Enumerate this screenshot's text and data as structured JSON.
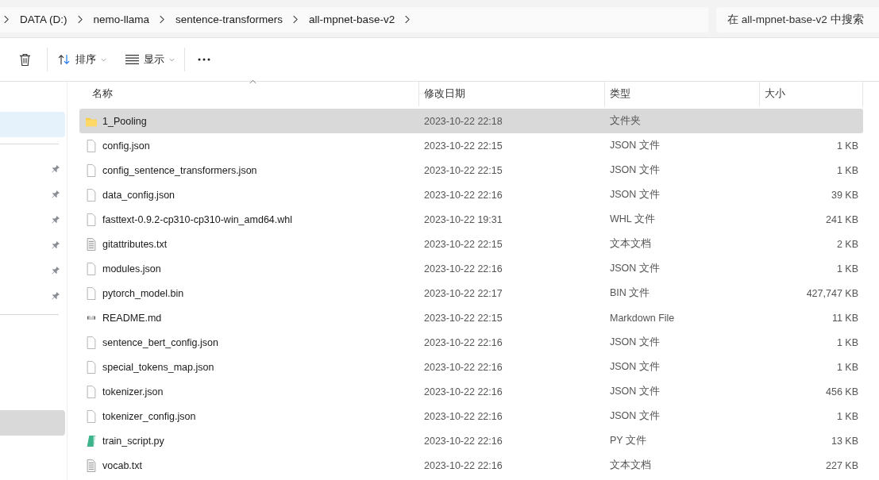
{
  "breadcrumb": {
    "crumbs": [
      "DATA (D:)",
      "nemo-llama",
      "sentence-transformers",
      "all-mpnet-base-v2"
    ]
  },
  "search": {
    "placeholder": "在 all-mpnet-base-v2 中搜索"
  },
  "toolbar": {
    "sort_label": "排序",
    "view_label": "显示"
  },
  "sidebar": {
    "items": [
      {
        "selected": true,
        "hovered": false,
        "pinned": false
      },
      {
        "selected": false,
        "hovered": false,
        "pinned": true
      },
      {
        "selected": false,
        "hovered": false,
        "pinned": true
      },
      {
        "selected": false,
        "hovered": false,
        "pinned": true
      },
      {
        "selected": false,
        "hovered": false,
        "pinned": true
      },
      {
        "selected": false,
        "hovered": false,
        "pinned": true
      },
      {
        "selected": false,
        "hovered": false,
        "pinned": true
      },
      {
        "selected": false,
        "hovered": true,
        "pinned": false
      }
    ]
  },
  "table": {
    "columns": [
      "名称",
      "修改日期",
      "类型",
      "大小"
    ],
    "rows": [
      {
        "kind": "folder",
        "name": "1_Pooling",
        "date": "2023-10-22 22:18",
        "type": "文件夹",
        "size": "",
        "selected": true
      },
      {
        "kind": "file",
        "name": "config.json",
        "date": "2023-10-22 22:15",
        "type": "JSON 文件",
        "size": "1 KB",
        "selected": false
      },
      {
        "kind": "file",
        "name": "config_sentence_transformers.json",
        "date": "2023-10-22 22:15",
        "type": "JSON 文件",
        "size": "1 KB",
        "selected": false
      },
      {
        "kind": "file",
        "name": "data_config.json",
        "date": "2023-10-22 22:16",
        "type": "JSON 文件",
        "size": "39 KB",
        "selected": false
      },
      {
        "kind": "file",
        "name": "fasttext-0.9.2-cp310-cp310-win_amd64.whl",
        "date": "2023-10-22 19:31",
        "type": "WHL 文件",
        "size": "241 KB",
        "selected": false
      },
      {
        "kind": "text",
        "name": "gitattributes.txt",
        "date": "2023-10-22 22:15",
        "type": "文本文档",
        "size": "2 KB",
        "selected": false
      },
      {
        "kind": "file",
        "name": "modules.json",
        "date": "2023-10-22 22:16",
        "type": "JSON 文件",
        "size": "1 KB",
        "selected": false
      },
      {
        "kind": "file",
        "name": "pytorch_model.bin",
        "date": "2023-10-22 22:17",
        "type": "BIN 文件",
        "size": "427,747 KB",
        "selected": false
      },
      {
        "kind": "markdown",
        "name": "README.md",
        "date": "2023-10-22 22:15",
        "type": "Markdown File",
        "size": "11 KB",
        "selected": false
      },
      {
        "kind": "file",
        "name": "sentence_bert_config.json",
        "date": "2023-10-22 22:16",
        "type": "JSON 文件",
        "size": "1 KB",
        "selected": false
      },
      {
        "kind": "file",
        "name": "special_tokens_map.json",
        "date": "2023-10-22 22:16",
        "type": "JSON 文件",
        "size": "1 KB",
        "selected": false
      },
      {
        "kind": "file",
        "name": "tokenizer.json",
        "date": "2023-10-22 22:16",
        "type": "JSON 文件",
        "size": "456 KB",
        "selected": false
      },
      {
        "kind": "file",
        "name": "tokenizer_config.json",
        "date": "2023-10-22 22:16",
        "type": "JSON 文件",
        "size": "1 KB",
        "selected": false
      },
      {
        "kind": "python",
        "name": "train_script.py",
        "date": "2023-10-22 22:16",
        "type": "PY 文件",
        "size": "13 KB",
        "selected": false
      },
      {
        "kind": "text",
        "name": "vocab.txt",
        "date": "2023-10-22 22:16",
        "type": "文本文档",
        "size": "227 KB",
        "selected": false
      }
    ]
  }
}
